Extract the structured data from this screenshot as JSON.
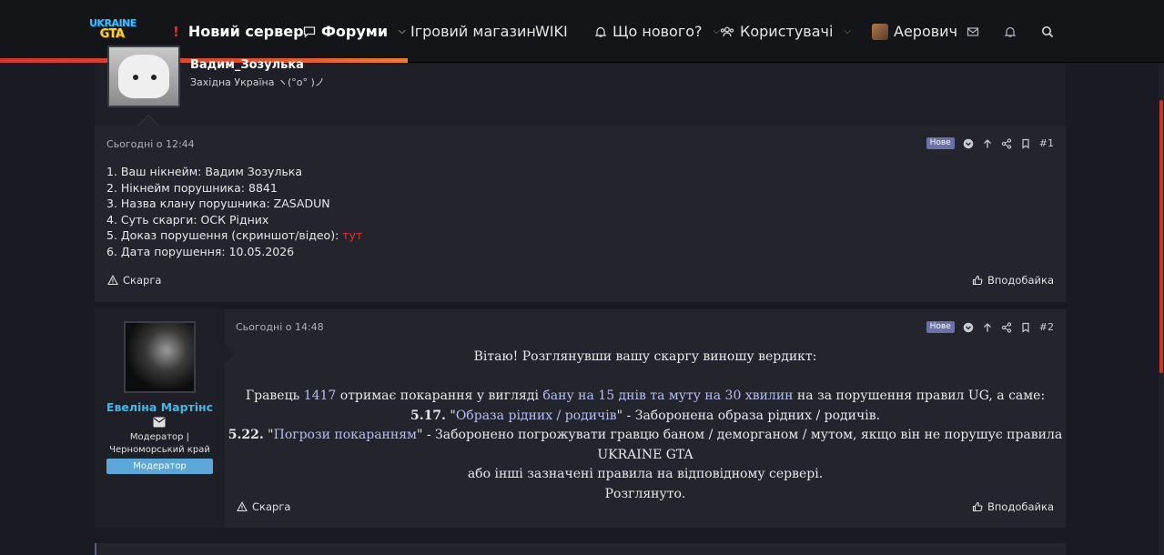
{
  "header": {
    "logo_line1": "UKRAINE",
    "logo_line2": "GTA",
    "nav": {
      "new_server": "Новий сервер",
      "forums": "Форуми",
      "shop": "Ігровий магазин",
      "wiki": "WIKI",
      "whats_new": "Що нового?",
      "users": "Користувачі",
      "username": "Аерович"
    },
    "accent": "#e0302d"
  },
  "posts": [
    {
      "author": "Вадим_Зозулька",
      "subtitle": "Західна Україна ヽ(°o° )ノ",
      "time": "Сьогодні о 12:44",
      "badge": "Нове",
      "number": "#1",
      "lines": [
        "1. Ваш нікнейм: Вадим Зозулька",
        "2. Нікнейм порушника: 8841",
        "3. Назва клану порушника: ZASADUN",
        "4. Суть скарги: ОСК Рідних",
        "5. Доказ порушення (скриншот/відео): ",
        "6. Дата порушення: 10.05.2026"
      ],
      "proof_link": "тут",
      "report_label": "Скарга",
      "like_label": "Вподобайка"
    },
    {
      "author": "Евеліна Мартінс",
      "role_line1": "Модератор |",
      "role_line2": "Черноморський край",
      "role_badge": "Модератор",
      "time": "Сьогодні о 14:48",
      "badge": "Нове",
      "number": "#2",
      "greeting": "Вітаю! Розглянувши вашу скаргу виношу вердикт:",
      "verdict_pre": "Гравець ",
      "verdict_id": "1417",
      "verdict_mid": " отримає покарання у вигляді ",
      "verdict_punish": "бану на 15 днів та муту на 30 хвилин",
      "verdict_post": " на за порушення правил UG, а саме:",
      "rule1_num": "5.17.",
      "rule1_q1": " \"",
      "rule1_title": "Образа рідних / родичів",
      "rule1_text": "\" - Заборонена образа рідних / родичів.",
      "rule2_num": "5.22.",
      "rule2_q1": " \"",
      "rule2_title": "Погрози покаранням",
      "rule2_text": "\" - Заборонено погрожувати гравцю баном / деморганом / мутом, якщо він не порушує правила UKRAINE GTA",
      "rule2_text2": "або інші зазначені правила на відповідному сервері.",
      "closing": "Розглянуто.",
      "report_label": "Скарга",
      "like_label": "Вподобайка"
    }
  ]
}
